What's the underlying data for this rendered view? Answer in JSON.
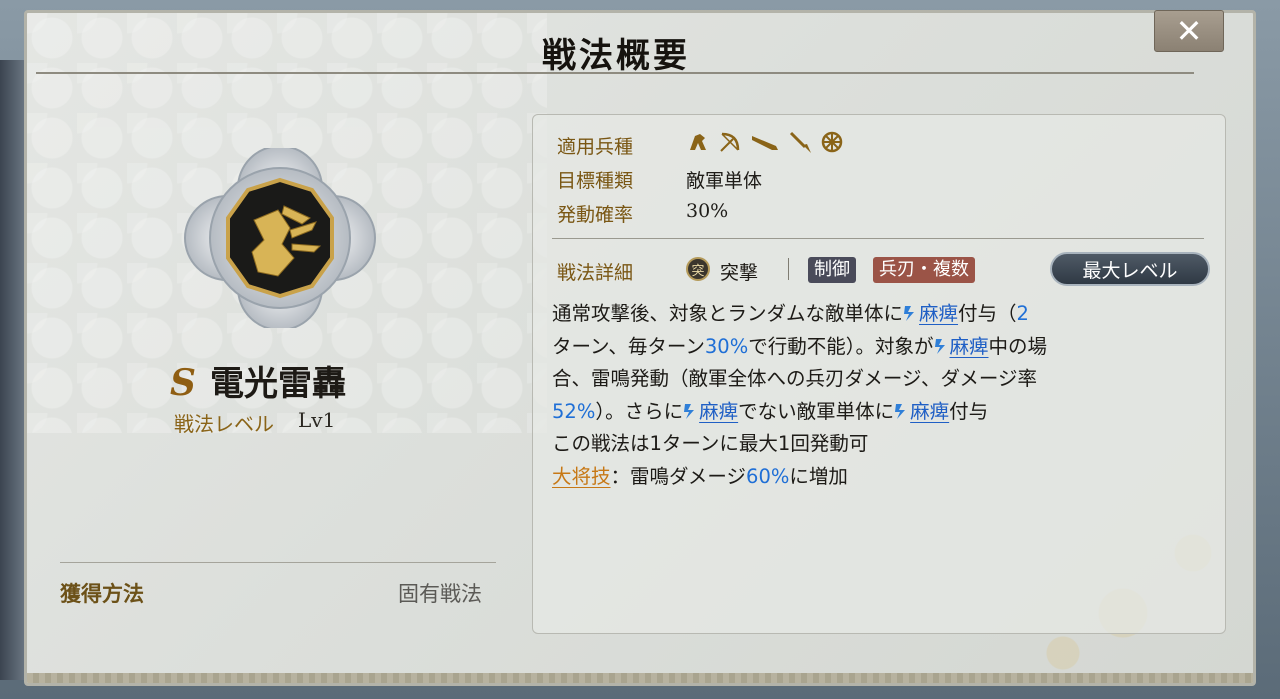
{
  "header": {
    "title": "戦法概要",
    "close_icon": "close-icon"
  },
  "skill": {
    "grade": "S",
    "name": "電光雷轟",
    "level_label": "戦法レベル",
    "level_value": "Lv1",
    "acquisition_label": "獲得方法",
    "acquisition_value": "固有戦法"
  },
  "info": {
    "troop_label": "適用兵種",
    "troop_icons": [
      "cavalry-icon",
      "bow-icon",
      "gun-icon",
      "spear-icon",
      "wheel-icon"
    ],
    "target_label": "目標種類",
    "target_value": "敵軍単体",
    "rate_label": "発動確率",
    "rate_value": "30%",
    "detail_label": "戦法詳細",
    "type_badge": "突",
    "type_label": "突撃",
    "tags": [
      "制御",
      "兵刃・複数"
    ],
    "max_level_button": "最大レベル"
  },
  "description": {
    "l1a": "通常攻撃後、対象とランダムな敵単体に",
    "paralysis": "麻痺",
    "l1b": "付与（",
    "n2": "2",
    "l2a": "ターン、毎ターン",
    "n30": "30%",
    "l2b": "で行動不能）。対象が",
    "l2c": "中の場",
    "l3": "合、雷鳴発動（敵軍全体への兵刃ダメージ、ダメージ率",
    "n52": "52%",
    "l4a": "）。さらに",
    "l4b": "でない敵軍単体に",
    "l4c": "付与",
    "l5": "この戦法は1ターンに最大1回発動可",
    "general_skill": "大将技",
    "l6a": "：雷鳴ダメージ",
    "n60": "60%",
    "l6b": "に増加"
  },
  "colors": {
    "accent_gold": "#8a6418",
    "highlight_blue": "#1f6fd6",
    "general_orange": "#c77815"
  }
}
